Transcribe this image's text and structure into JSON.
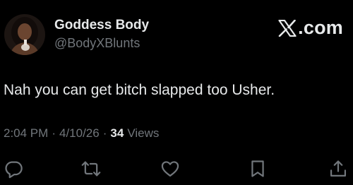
{
  "author": {
    "display_name": "Goddess Body",
    "handle": "@BodyXBlunts",
    "avatar_icon": "profile-photo"
  },
  "brand": {
    "text": ".com",
    "logo_icon": "x-logo-icon"
  },
  "tweet": {
    "text": "Nah you can get bitch slapped too Usher."
  },
  "meta": {
    "time": "2:04 PM",
    "separator": "·",
    "date": "4/10/26",
    "views_count": "34",
    "views_label": "Views"
  },
  "actions": [
    {
      "name": "reply",
      "icon": "reply-icon"
    },
    {
      "name": "retweet",
      "icon": "retweet-icon"
    },
    {
      "name": "like",
      "icon": "heart-icon"
    },
    {
      "name": "bookmark",
      "icon": "bookmark-icon"
    },
    {
      "name": "share",
      "icon": "share-icon"
    }
  ],
  "colors": {
    "background": "#000000",
    "primary_text": "#e7e9ea",
    "secondary_text": "#71767b"
  }
}
